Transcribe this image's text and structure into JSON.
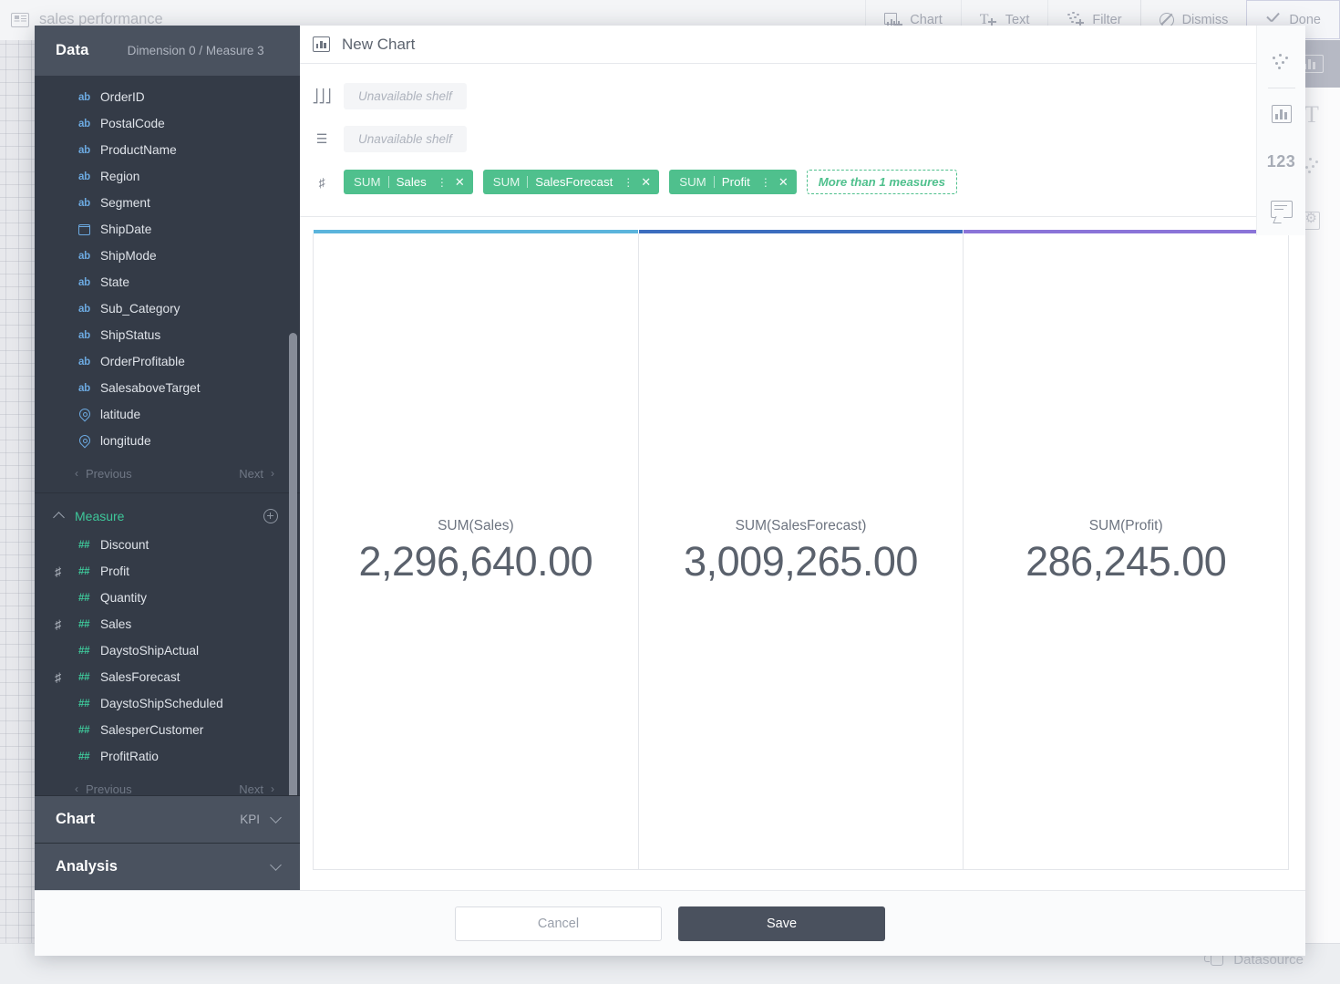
{
  "background": {
    "doc_title": "sales performance",
    "doc_icon": "dashboard-icon",
    "toolbar": [
      {
        "label": "Chart",
        "icon": "chart-plus-icon"
      },
      {
        "label": "Text",
        "icon": "text-plus-icon"
      },
      {
        "label": "Filter",
        "icon": "filter-plus-icon"
      },
      {
        "label": "Dismiss",
        "icon": "ban-icon"
      },
      {
        "label": "Done",
        "icon": "check-icon"
      }
    ],
    "datasource_label": "Datasource"
  },
  "modal": {
    "left_panel": {
      "header": {
        "title": "Data",
        "summary": "Dimension 0 / Measure 3"
      },
      "dimension_fields": [
        {
          "name": "OrderID",
          "type": "ab",
          "icon": "text-field-icon",
          "in_use": false
        },
        {
          "name": "PostalCode",
          "type": "ab",
          "icon": "text-field-icon",
          "in_use": false
        },
        {
          "name": "ProductName",
          "type": "ab",
          "icon": "text-field-icon",
          "in_use": false
        },
        {
          "name": "Region",
          "type": "ab",
          "icon": "text-field-icon",
          "in_use": false
        },
        {
          "name": "Segment",
          "type": "ab",
          "icon": "text-field-icon",
          "in_use": false
        },
        {
          "name": "ShipDate",
          "type": "date",
          "icon": "calendar-icon",
          "in_use": false
        },
        {
          "name": "ShipMode",
          "type": "ab",
          "icon": "text-field-icon",
          "in_use": false
        },
        {
          "name": "State",
          "type": "ab",
          "icon": "text-field-icon",
          "in_use": false
        },
        {
          "name": "Sub_Category",
          "type": "ab",
          "icon": "text-field-icon",
          "in_use": false
        },
        {
          "name": "ShipStatus",
          "type": "ab",
          "icon": "text-field-icon",
          "in_use": false
        },
        {
          "name": "OrderProfitable",
          "type": "ab",
          "icon": "text-field-icon",
          "in_use": false
        },
        {
          "name": "SalesaboveTarget",
          "type": "ab",
          "icon": "text-field-icon",
          "in_use": false
        },
        {
          "name": "latitude",
          "type": "geo",
          "icon": "location-pin-icon",
          "in_use": false
        },
        {
          "name": "longitude",
          "type": "geo",
          "icon": "location-pin-icon",
          "in_use": false
        }
      ],
      "dimension_pager": {
        "previous": "Previous",
        "next": "Next"
      },
      "measure_section": {
        "title": "Measure",
        "add_icon": "plus-circle-icon",
        "collapse_icon": "chevron-up-icon"
      },
      "measure_fields": [
        {
          "name": "Discount",
          "type": "##",
          "in_use": false
        },
        {
          "name": "Profit",
          "type": "##",
          "in_use": true
        },
        {
          "name": "Quantity",
          "type": "##",
          "in_use": false
        },
        {
          "name": "Sales",
          "type": "##",
          "in_use": true
        },
        {
          "name": "DaystoShipActual",
          "type": "##",
          "in_use": false
        },
        {
          "name": "SalesForecast",
          "type": "##",
          "in_use": true
        },
        {
          "name": "DaystoShipScheduled",
          "type": "##",
          "in_use": false
        },
        {
          "name": "SalesperCustomer",
          "type": "##",
          "in_use": false
        },
        {
          "name": "ProfitRatio",
          "type": "##",
          "in_use": false
        }
      ],
      "measure_pager": {
        "previous": "Previous",
        "next": "Next"
      },
      "accordions": [
        {
          "title": "Chart",
          "value": "KPI",
          "icon": "chevron-down-icon"
        },
        {
          "title": "Analysis",
          "value": "",
          "icon": "chevron-down-icon"
        }
      ]
    },
    "chart_header": {
      "title": "New Chart",
      "icon": "bar-chart-icon"
    },
    "shelves": [
      {
        "icon": "columns-shelf-icon",
        "placeholder": "Unavailable  shelf",
        "pills": []
      },
      {
        "icon": "rows-shelf-icon",
        "placeholder": "Unavailable  shelf",
        "pills": []
      },
      {
        "icon": "measure-shelf-icon",
        "placeholder": "",
        "pills": [
          {
            "agg": "SUM",
            "field": "Sales",
            "menu_icon": "kebab-icon",
            "remove_icon": "close-icon"
          },
          {
            "agg": "SUM",
            "field": "SalesForecast",
            "menu_icon": "kebab-icon",
            "remove_icon": "close-icon"
          },
          {
            "agg": "SUM",
            "field": "Profit",
            "menu_icon": "kebab-icon",
            "remove_icon": "close-icon"
          }
        ],
        "ghost_label": "More than 1 measures"
      }
    ],
    "footer": {
      "cancel": "Cancel",
      "save": "Save"
    }
  },
  "chart_data": {
    "type": "table",
    "title": "New Chart",
    "chart_kind": "KPI",
    "categories": [
      "SUM(Sales)",
      "SUM(SalesForecast)",
      "SUM(Profit)"
    ],
    "values": [
      2296640.0,
      3009265.0,
      286245.0
    ],
    "display_values": [
      "2,296,640.00",
      "3,009,265.00",
      "286,245.00"
    ],
    "colors": [
      "#5bb4dc",
      "#3c6dbf",
      "#8a74d8"
    ],
    "cards": [
      {
        "label": "SUM(Sales)",
        "value": "2,296,640.00",
        "color": "#5bb4dc"
      },
      {
        "label": "SUM(SalesForecast)",
        "value": "3,009,265.00",
        "color": "#3c6dbf"
      },
      {
        "label": "SUM(Profit)",
        "value": "286,245.00",
        "color": "#8a74d8"
      }
    ]
  },
  "rail": {
    "items": [
      {
        "icon": "filter-dots-icon"
      },
      {
        "icon": "bar-chart-icon"
      },
      {
        "icon": "number-format-icon",
        "label": "123"
      },
      {
        "icon": "comment-icon"
      }
    ]
  }
}
